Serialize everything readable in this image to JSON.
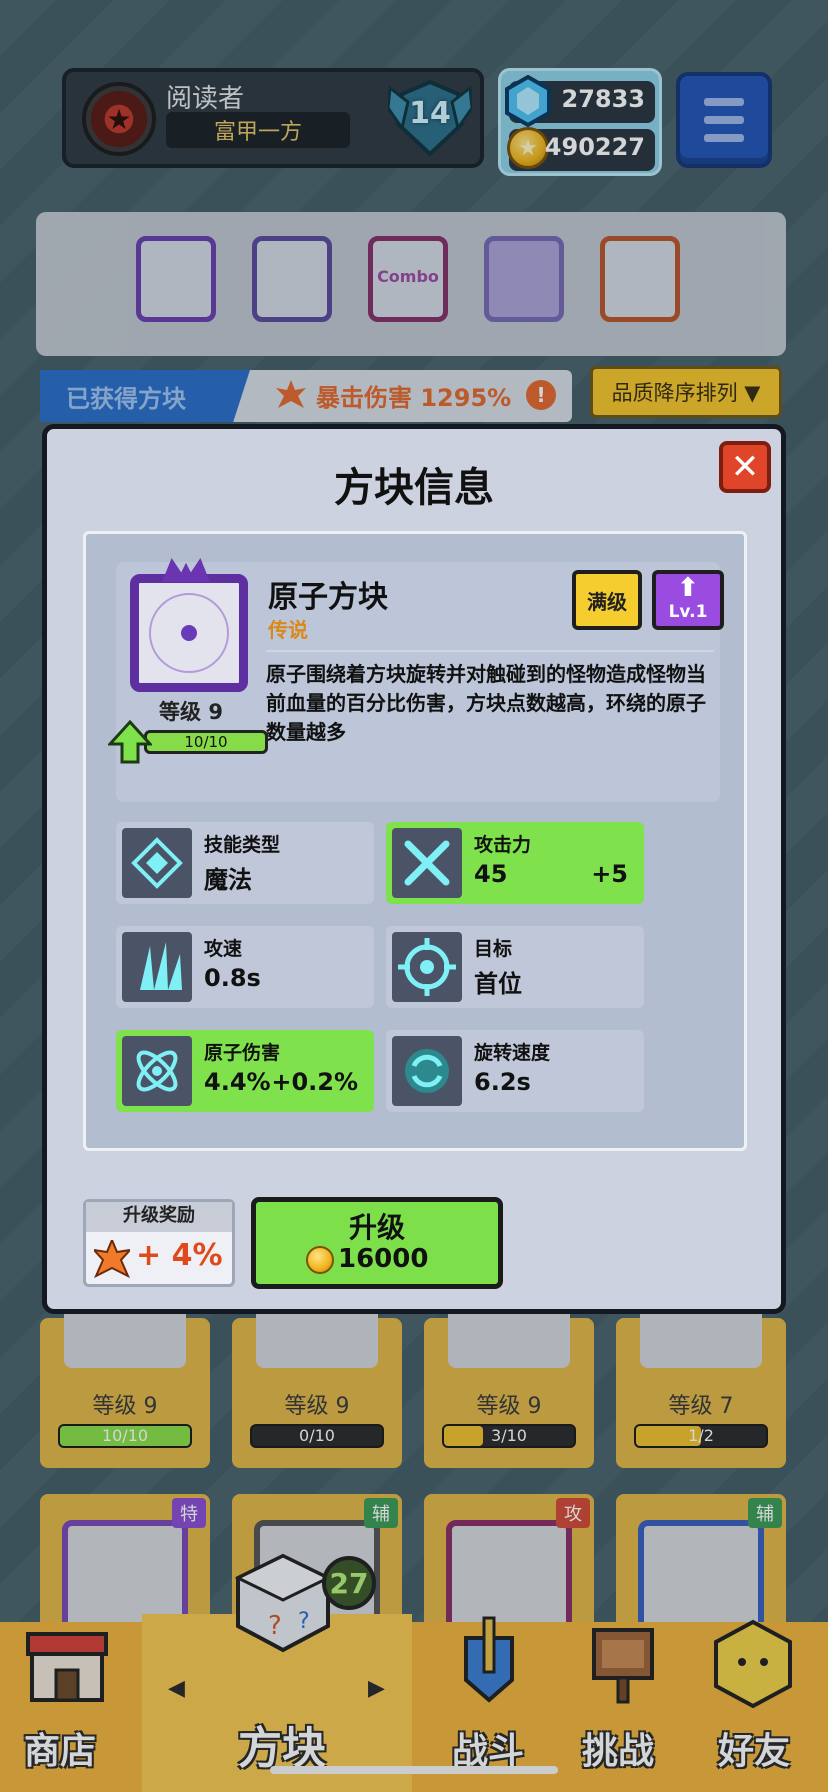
{
  "profile": {
    "name": "阅读者",
    "title": "富甲一方",
    "rank_level": "14"
  },
  "currency": {
    "gems": "27833",
    "coins": "490227"
  },
  "tray": {
    "block_label": "Combo"
  },
  "subbar": {
    "collected_label": "已获得方块",
    "crit_label": "暴击伤害 1295%",
    "info_mark": "!",
    "sort_label": "品质降序排列 ▼"
  },
  "modal": {
    "title": "方块信息",
    "close": "✕",
    "block": {
      "name": "原子方块",
      "rarity": "传说",
      "max_label": "满级",
      "lv_label": "Lv.1",
      "level_label": "等级 9",
      "progress": "10/10",
      "description": "原子围绕着方块旋转并对触碰到的怪物造成怪物当前血量的百分比伤害，方块点数越高，环绕的原子数量越多"
    },
    "stats": [
      {
        "label": "技能类型",
        "value": "魔法",
        "bonus": "",
        "highlight": false,
        "icon": "magic-icon"
      },
      {
        "label": "攻击力",
        "value": "45",
        "bonus": "+5",
        "highlight": true,
        "icon": "swords-icon"
      },
      {
        "label": "攻速",
        "value": "0.8s",
        "bonus": "",
        "highlight": false,
        "icon": "attack-speed-icon"
      },
      {
        "label": "目标",
        "value": "首位",
        "bonus": "",
        "highlight": false,
        "icon": "target-icon"
      },
      {
        "label": "原子伤害",
        "value": "4.4%",
        "bonus": "+0.2%",
        "highlight": true,
        "icon": "atom-icon"
      },
      {
        "label": "旋转速度",
        "value": "6.2s",
        "bonus": "",
        "highlight": false,
        "icon": "rotation-icon"
      }
    ],
    "reward": {
      "title": "升级奖励",
      "value": "+ 4%"
    },
    "upgrade": {
      "label": "升级",
      "cost": "16000"
    }
  },
  "grid": {
    "row1": [
      {
        "level": "等级 9",
        "progress": "10/10",
        "fill": 1.0
      },
      {
        "level": "等级 9",
        "progress": "0/10",
        "fill": 0.0
      },
      {
        "level": "等级 9",
        "progress": "3/10",
        "fill": 0.3
      },
      {
        "level": "等级 7",
        "progress": "1/2",
        "fill": 0.5
      }
    ],
    "row2": [
      {
        "tag": "特",
        "tag_color": "#8a4fd4"
      },
      {
        "tag": "辅",
        "tag_color": "#3e9c57"
      },
      {
        "tag": "攻",
        "tag_color": "#d44a3a"
      },
      {
        "tag": "辅",
        "tag_color": "#3e9c57"
      }
    ]
  },
  "nav": {
    "shop": "商店",
    "blocks": "方块",
    "battle": "战斗",
    "challenge": "挑战",
    "friends": "好友",
    "cube_count": "27",
    "prev": "◀",
    "next": "▶"
  }
}
